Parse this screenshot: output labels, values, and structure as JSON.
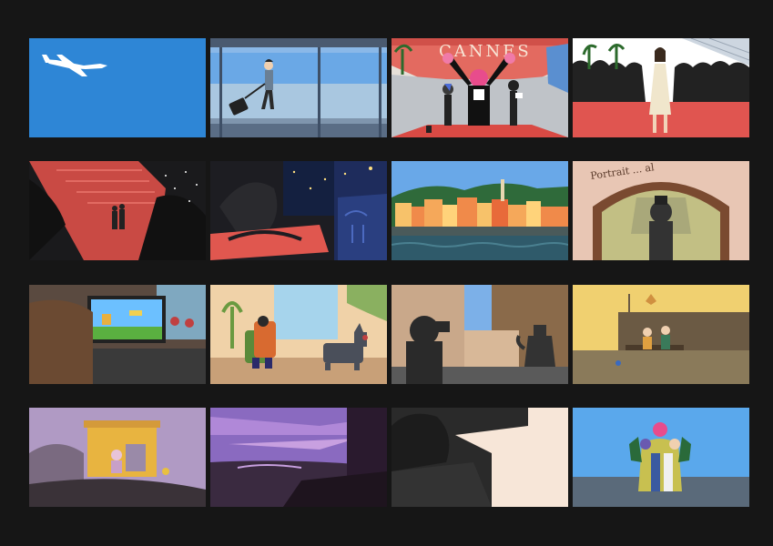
{
  "storyboard": {
    "panels": [
      {
        "id": 1,
        "scene": "plane"
      },
      {
        "id": 2,
        "scene": "airport"
      },
      {
        "id": 3,
        "scene": "cannes-red-carpet",
        "sign_text": "CANNES"
      },
      {
        "id": 4,
        "scene": "actress-crowd"
      },
      {
        "id": 5,
        "scene": "night-stairs"
      },
      {
        "id": 6,
        "scene": "hotel-night"
      },
      {
        "id": 7,
        "scene": "coastal-town"
      },
      {
        "id": 8,
        "scene": "photographer-archway",
        "sign_text": "Portrait ... al"
      },
      {
        "id": 9,
        "scene": "tv-game"
      },
      {
        "id": 10,
        "scene": "backpack-dog"
      },
      {
        "id": 11,
        "scene": "photographer-kettle"
      },
      {
        "id": 12,
        "scene": "couple-bench"
      },
      {
        "id": 13,
        "scene": "hut-dusk"
      },
      {
        "id": 14,
        "scene": "purple-lake"
      },
      {
        "id": 15,
        "scene": "cliff-silhouette"
      },
      {
        "id": 16,
        "scene": "group-hug"
      }
    ]
  },
  "colors": {
    "background": "#161616",
    "sky_blue": "#2e86d6",
    "cannes_red": "#e0584f",
    "night": "#1b1b1f"
  }
}
